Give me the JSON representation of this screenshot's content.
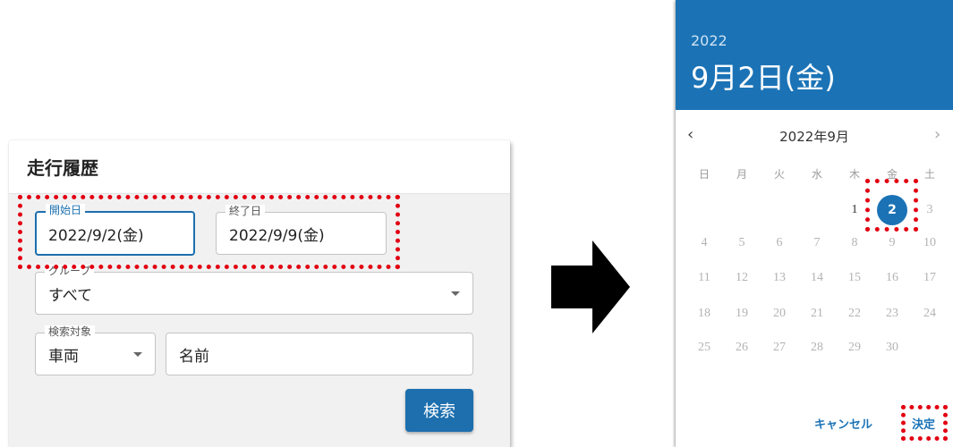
{
  "panel": {
    "title": "走行履歴",
    "start_date": {
      "label": "開始日",
      "value": "2022/9/2(金)"
    },
    "end_date": {
      "label": "終了日",
      "value": "2022/9/9(金)"
    },
    "group": {
      "label": "グループ",
      "value": "すべて"
    },
    "target": {
      "label": "検索対象",
      "value": "車両"
    },
    "name": {
      "placeholder": "名前"
    },
    "search_label": "検索"
  },
  "picker": {
    "year": "2022",
    "selected_date": "9月2日(金)",
    "month_label": "2022年9月",
    "prev_icon": "‹",
    "next_icon": "›",
    "weekdays": [
      "日",
      "月",
      "火",
      "水",
      "木",
      "金",
      "土"
    ],
    "days": {
      "1": "1",
      "2": "2",
      "3": "3",
      "4": "4",
      "5": "5",
      "6": "6",
      "7": "7",
      "8": "8",
      "9": "9",
      "10": "10",
      "11": "11",
      "12": "12",
      "13": "13",
      "14": "14",
      "15": "15",
      "16": "16",
      "17": "17",
      "18": "18",
      "19": "19",
      "20": "20",
      "21": "21",
      "22": "22",
      "23": "23",
      "24": "24",
      "25": "25",
      "26": "26",
      "27": "27",
      "28": "28",
      "29": "29",
      "30": "30"
    },
    "cancel_label": "キャンセル",
    "ok_label": "決定"
  },
  "colors": {
    "accent": "#1b73b6",
    "highlight": "#e20012"
  }
}
